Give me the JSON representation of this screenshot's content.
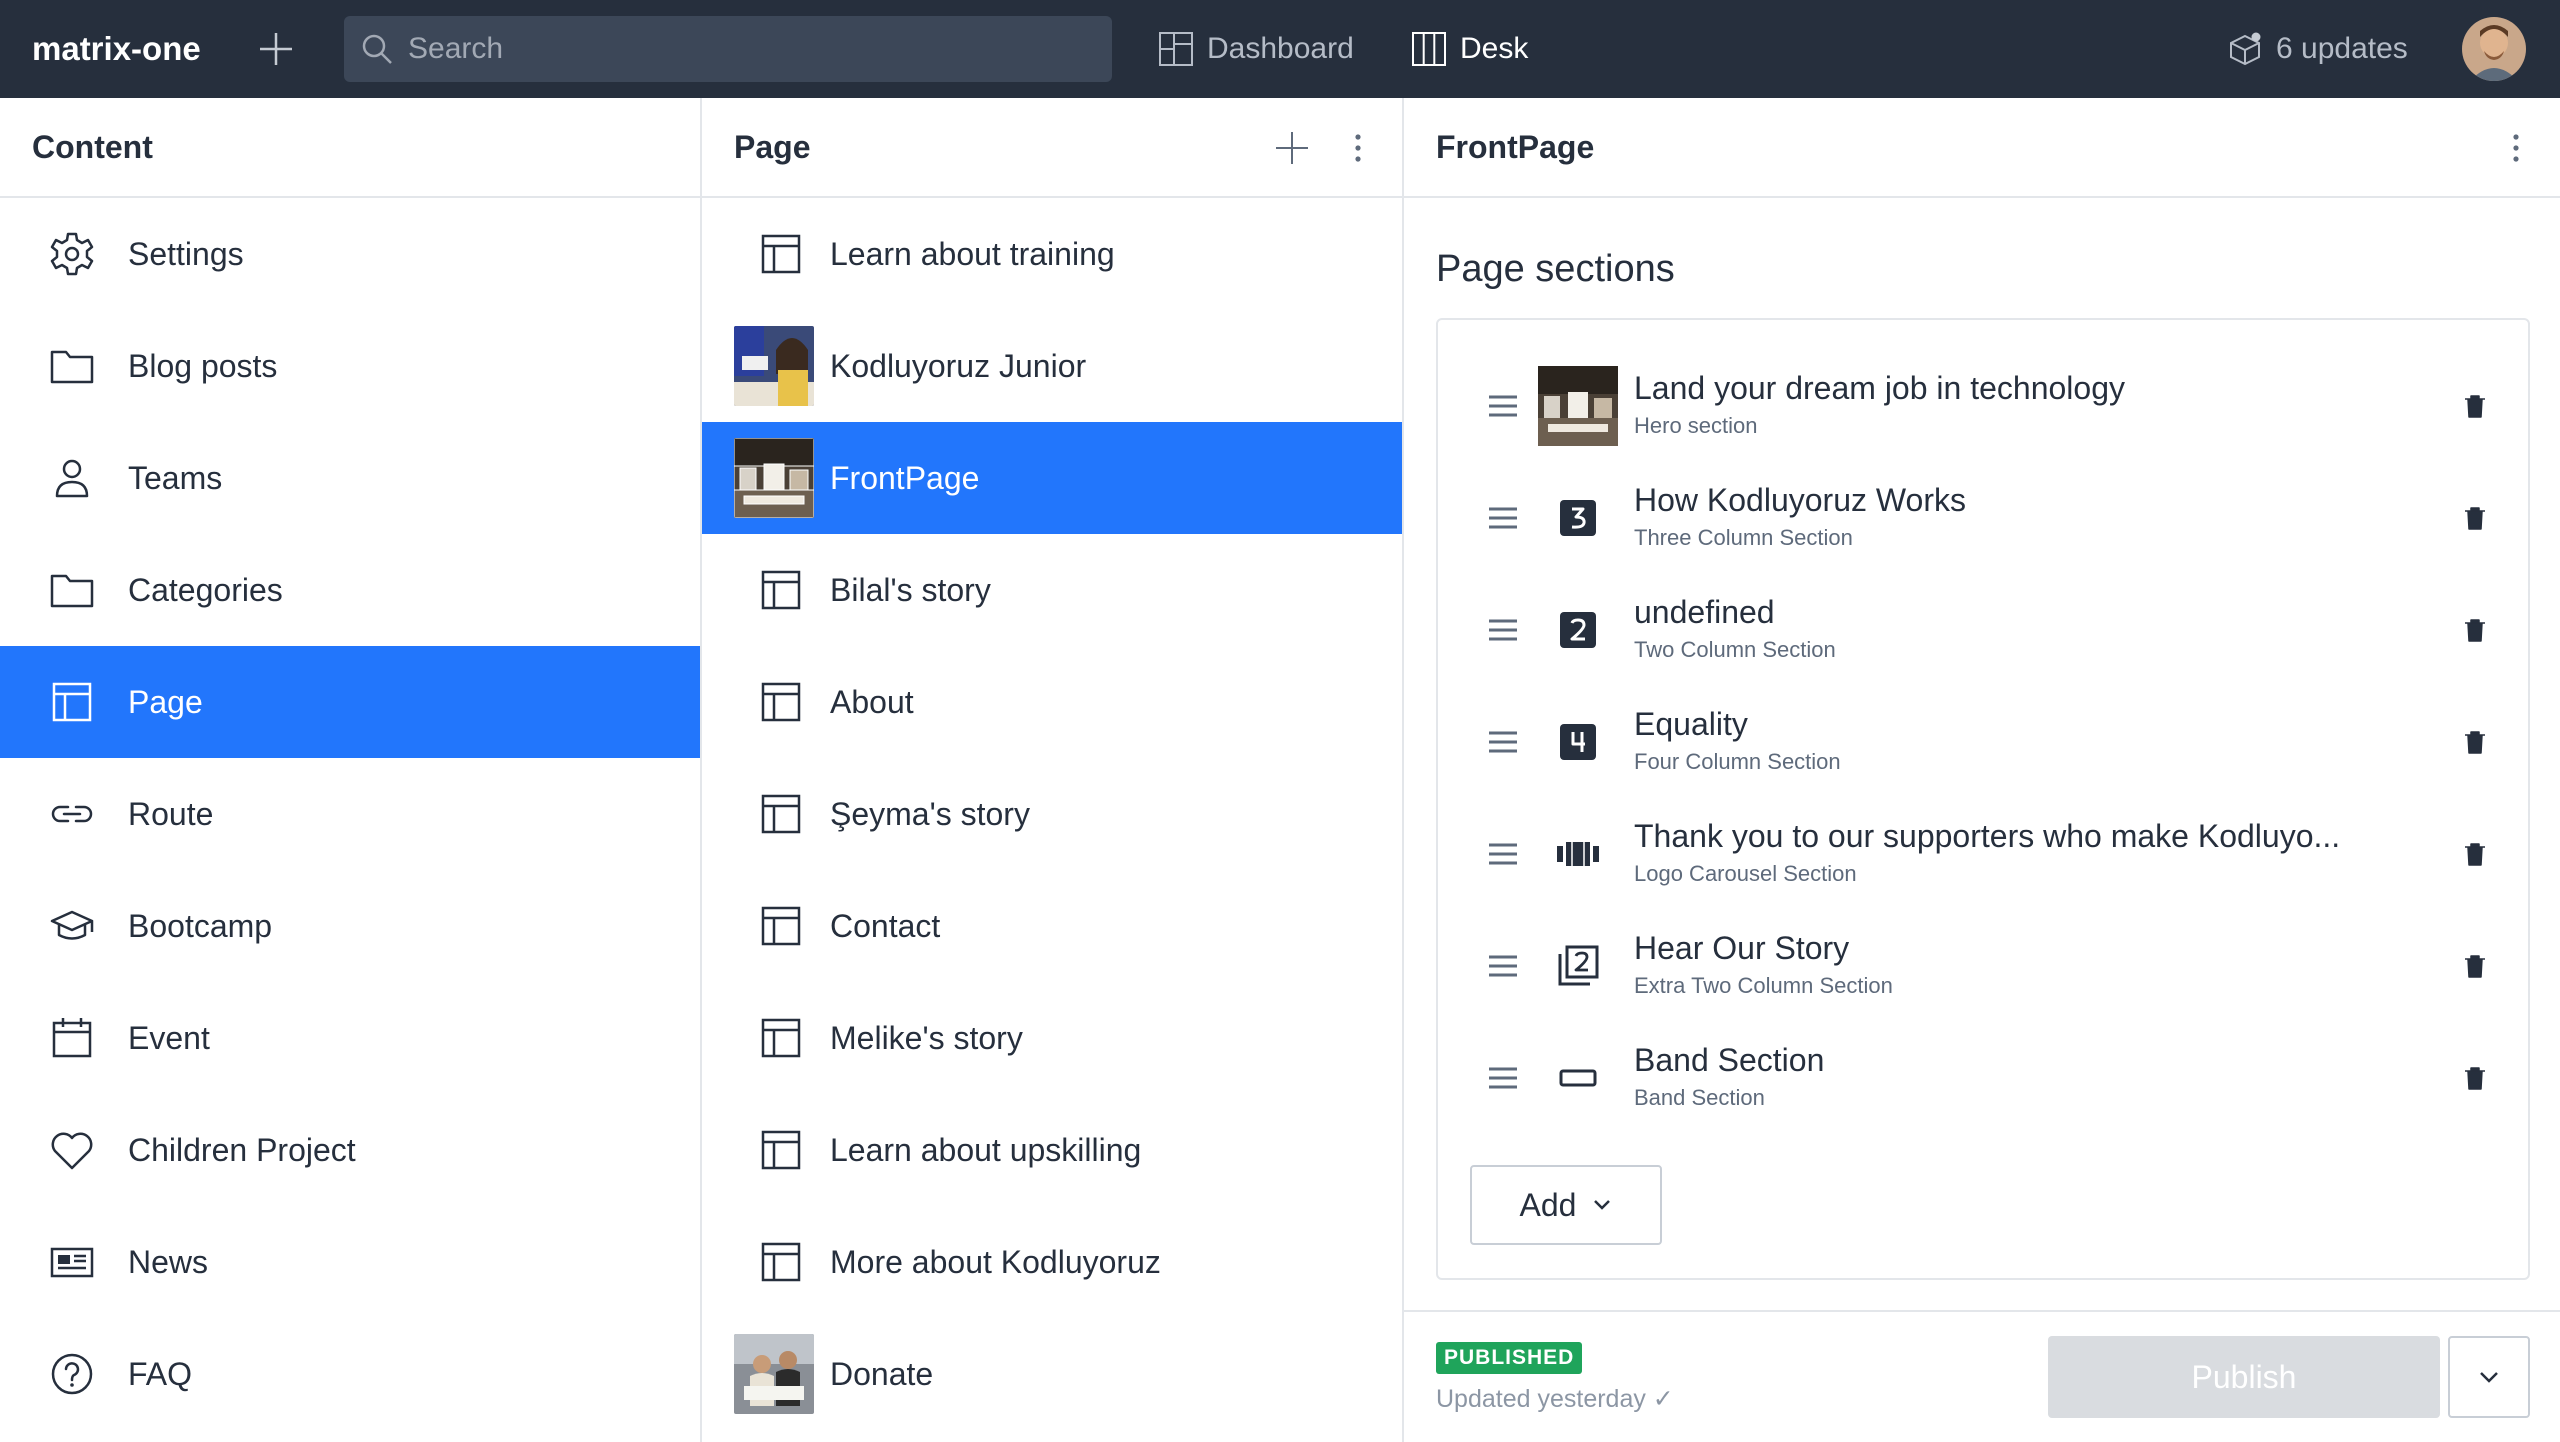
{
  "navbar": {
    "brand": "matrix-one",
    "search_placeholder": "Search",
    "dashboard_label": "Dashboard",
    "desk_label": "Desk",
    "updates_label": "6 updates"
  },
  "content_pane": {
    "title": "Content",
    "items": [
      {
        "label": "Settings",
        "icon": "gear-icon"
      },
      {
        "label": "Blog posts",
        "icon": "folder-icon"
      },
      {
        "label": "Teams",
        "icon": "user-icon"
      },
      {
        "label": "Categories",
        "icon": "folder-icon"
      },
      {
        "label": "Page",
        "icon": "layout-icon",
        "selected": true
      },
      {
        "label": "Route",
        "icon": "link-icon"
      },
      {
        "label": "Bootcamp",
        "icon": "graduation-cap-icon"
      },
      {
        "label": "Event",
        "icon": "calendar-icon"
      },
      {
        "label": "Children Project",
        "icon": "heart-icon"
      },
      {
        "label": "News",
        "icon": "newspaper-icon"
      },
      {
        "label": "FAQ",
        "icon": "question-icon"
      }
    ]
  },
  "page_pane": {
    "title": "Page",
    "items": [
      {
        "label": "Learn about training",
        "icon": "layout-icon"
      },
      {
        "label": "Kodluyoruz Junior",
        "icon": "thumbnail-image"
      },
      {
        "label": "FrontPage",
        "icon": "thumbnail-image",
        "selected": true
      },
      {
        "label": "Bilal's story",
        "icon": "layout-icon"
      },
      {
        "label": "About",
        "icon": "layout-icon"
      },
      {
        "label": "Şeyma's story",
        "icon": "layout-icon"
      },
      {
        "label": "Contact",
        "icon": "layout-icon"
      },
      {
        "label": "Melike's story",
        "icon": "layout-icon"
      },
      {
        "label": "Learn about upskilling",
        "icon": "layout-icon"
      },
      {
        "label": "More about Kodluyoruz",
        "icon": "layout-icon"
      },
      {
        "label": "Donate",
        "icon": "thumbnail-image"
      }
    ]
  },
  "document": {
    "title": "FrontPage",
    "sections_heading": "Page sections",
    "sections": [
      {
        "title": "Land your dream job in technology",
        "subtitle": "Hero section",
        "icon": "thumbnail-image"
      },
      {
        "title": "How Kodluyoruz Works",
        "subtitle": "Three Column Section",
        "icon": "number-3-icon"
      },
      {
        "title": "undefined",
        "subtitle": "Two Column Section",
        "icon": "number-2-icon"
      },
      {
        "title": "Equality",
        "subtitle": "Four Column Section",
        "icon": "number-4-icon"
      },
      {
        "title": "Thank you to our supporters who make Kodluyo...",
        "subtitle": "Logo Carousel Section",
        "icon": "carousel-icon"
      },
      {
        "title": "Hear Our Story",
        "subtitle": "Extra Two Column Section",
        "icon": "stack-2-icon"
      },
      {
        "title": "Band Section",
        "subtitle": "Band Section",
        "icon": "band-icon"
      }
    ],
    "add_label": "Add",
    "status_badge": "PUBLISHED",
    "updated_text": "Updated yesterday ✓",
    "publish_label": "Publish"
  },
  "colors": {
    "navbar_bg": "#262f3d",
    "accent": "#2276fc",
    "published": "#1fa45b",
    "publish_disabled": "#d9dce0"
  }
}
